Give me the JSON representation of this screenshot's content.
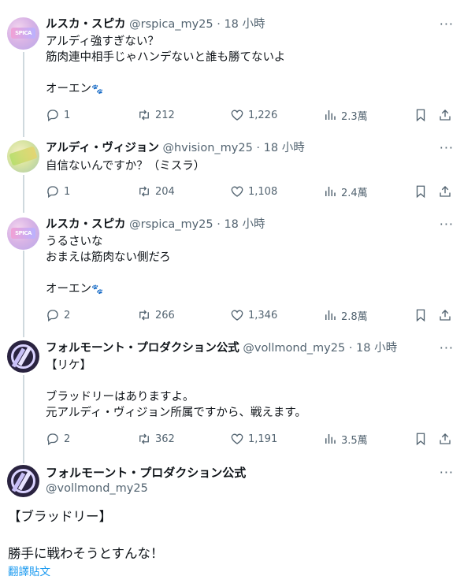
{
  "tweets": [
    {
      "name": "ルスカ・スピカ",
      "handle": "@rspica_my25",
      "dot": "·",
      "time": "18 小時",
      "lines": [
        "アルディ強すぎない？",
        "筋肉連中相手じゃハンデないと誰も勝てないよ",
        "",
        "オーエン"
      ],
      "emoji": "🐾",
      "stats": {
        "replies": "1",
        "retweets": "212",
        "likes": "1,226",
        "views": "2.3萬"
      }
    },
    {
      "name": "アルディ・ヴィジョン",
      "handle": "@hvision_my25",
      "dot": "·",
      "time": "18 小時",
      "lines": [
        "自信ないんですか？（ミスラ）"
      ],
      "stats": {
        "replies": "1",
        "retweets": "204",
        "likes": "1,108",
        "views": "2.4萬"
      }
    },
    {
      "name": "ルスカ・スピカ",
      "handle": "@rspica_my25",
      "dot": "·",
      "time": "18 小時",
      "lines": [
        "うるさいな",
        "おまえは筋肉ない側だろ",
        "",
        "オーエン"
      ],
      "emoji": "🐾",
      "stats": {
        "replies": "2",
        "retweets": "266",
        "likes": "1,346",
        "views": "2.8萬"
      }
    },
    {
      "name": "フォルモーント・プロダクション公式",
      "handle": "@vollmond_my25",
      "dot": "·",
      "time": "18 小時",
      "lines": [
        "【リケ】",
        "",
        "ブラッドリーはありますよ。",
        "元アルディ・ヴィジョン所属ですから、戦えます。"
      ],
      "stats": {
        "replies": "2",
        "retweets": "362",
        "likes": "1,191",
        "views": "3.5萬"
      }
    }
  ],
  "main_tweet": {
    "name": "フォルモーント・プロダクション公式",
    "handle": "@vollmond_my25",
    "line1": "【ブラッドリー】",
    "line2": "勝手に戦わそうとすんな！",
    "translate": "翻譯貼文"
  },
  "more_glyph": "···",
  "colors": {
    "text": "#0f1419",
    "muted": "#536471",
    "link": "#1d9bf0",
    "thread": "#cfd9de"
  }
}
